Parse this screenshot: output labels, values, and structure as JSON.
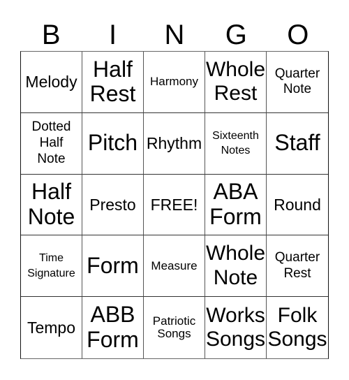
{
  "card": {
    "header_letters": [
      "B",
      "I",
      "N",
      "G",
      "O"
    ],
    "cells": [
      {
        "label": "Melody",
        "size": "m"
      },
      {
        "label": "Half\nRest",
        "size": "xl"
      },
      {
        "label": "Harmony",
        "size": "xs"
      },
      {
        "label": "Whole\nRest",
        "size": "l"
      },
      {
        "label": "Quarter\nNote",
        "size": "s"
      },
      {
        "label": "Dotted\nHalf\nNote",
        "size": "s"
      },
      {
        "label": "Pitch",
        "size": "xl"
      },
      {
        "label": "Rhythm",
        "size": "m"
      },
      {
        "label": "Sixteenth\nNotes",
        "size": "xxs"
      },
      {
        "label": "Staff",
        "size": "xl"
      },
      {
        "label": "Half\nNote",
        "size": "xl"
      },
      {
        "label": "Presto",
        "size": "m"
      },
      {
        "label": "FREE!",
        "size": "m"
      },
      {
        "label": "ABA\nForm",
        "size": "xl"
      },
      {
        "label": "Round",
        "size": "m"
      },
      {
        "label": "Time\nSignature",
        "size": "xxs"
      },
      {
        "label": "Form",
        "size": "xl"
      },
      {
        "label": "Measure",
        "size": "xs"
      },
      {
        "label": "Whole\nNote",
        "size": "l"
      },
      {
        "label": "Quarter\nRest",
        "size": "s"
      },
      {
        "label": "Tempo",
        "size": "m"
      },
      {
        "label": "ABB\nForm",
        "size": "xl"
      },
      {
        "label": "Patriotic\nSongs",
        "size": "xs"
      },
      {
        "label": "Works\nSongs",
        "size": "l"
      },
      {
        "label": "Folk\nSongs",
        "size": "l"
      }
    ],
    "free_space": "FREE!"
  }
}
